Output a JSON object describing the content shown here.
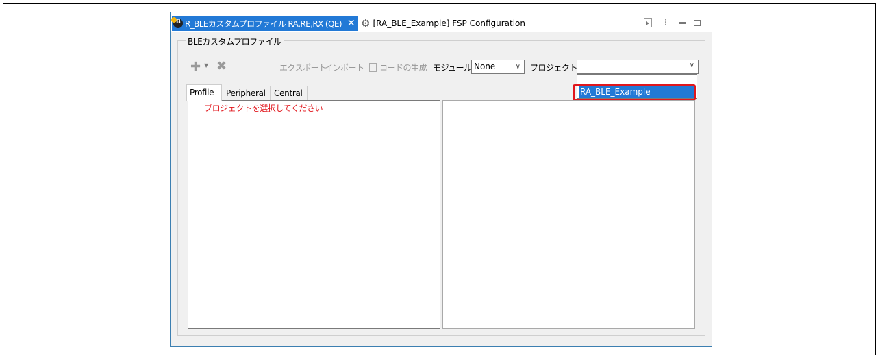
{
  "tabs": {
    "active": {
      "label": "R_BLEカスタムプロファイル RA,RE,RX (QE)",
      "close": "✕"
    },
    "inactive": {
      "label": "[RA_BLE_Example] FSP Configuration"
    }
  },
  "window_controls": {
    "more": "⁝"
  },
  "group_title": "BLEカスタムプロファイル",
  "toolbar": {
    "add": "✚",
    "dropdown": "▼",
    "delete": "✖",
    "export": "エクスポート",
    "import": "インポート",
    "generate": "コードの生成",
    "module_label": "モジュール:",
    "module_value": "None",
    "project_label": "プロジェクト:"
  },
  "project_dropdown": {
    "options": [
      "",
      "RA_BLE_Example"
    ],
    "highlighted": "RA_BLE_Example"
  },
  "subtabs": [
    "Profile",
    "Peripheral",
    "Central"
  ],
  "left_pane": {
    "hint": "プロジェクトを選択してください"
  },
  "icons": {
    "tab_profile": "profile-icon",
    "tab_fsp": "gear-icon",
    "sync": "sync-icon",
    "minimize": "minimize-icon",
    "maximize": "maximize-icon"
  },
  "colors": {
    "accent": "#2279d6",
    "highlight": "#e1161c",
    "hint_text": "#e1161c"
  }
}
